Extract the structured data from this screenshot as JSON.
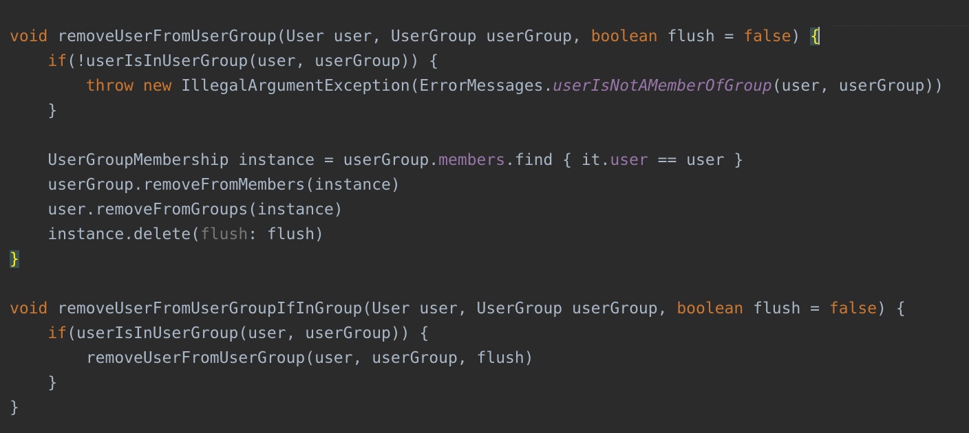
{
  "editor": {
    "lines": [
      {
        "tokens": [
          {
            "text": "void",
            "style": "kw"
          },
          {
            "text": " removeUserFromUserGroup(User user, UserGroup userGroup, ",
            "style": "plain"
          },
          {
            "text": "boolean",
            "style": "kw"
          },
          {
            "text": " flush = ",
            "style": "plain"
          },
          {
            "text": "false",
            "style": "kw"
          },
          {
            "text": ") ",
            "style": "plain"
          },
          {
            "text": "{",
            "style": "brace-match",
            "caret": true
          }
        ]
      },
      {
        "tokens": [
          {
            "text": "    ",
            "style": "plain"
          },
          {
            "text": "if",
            "style": "kw"
          },
          {
            "text": "(!userIsInUserGroup(user, userGroup)) {",
            "style": "plain"
          }
        ]
      },
      {
        "tokens": [
          {
            "text": "        ",
            "style": "plain"
          },
          {
            "text": "throw new",
            "style": "kw"
          },
          {
            "text": " IllegalArgumentException(ErrorMessages.",
            "style": "plain"
          },
          {
            "text": "userIsNotAMemberOfGroup",
            "style": "static"
          },
          {
            "text": "(user, userGroup))",
            "style": "plain"
          }
        ]
      },
      {
        "tokens": [
          {
            "text": "    }",
            "style": "plain"
          }
        ]
      },
      {
        "tokens": []
      },
      {
        "tokens": [
          {
            "text": "    UserGroupMembership instance = userGroup.",
            "style": "plain"
          },
          {
            "text": "members",
            "style": "field"
          },
          {
            "text": ".find { it.",
            "style": "plain"
          },
          {
            "text": "user",
            "style": "field"
          },
          {
            "text": " == user }",
            "style": "plain"
          }
        ]
      },
      {
        "tokens": [
          {
            "text": "    userGroup.removeFromMembers(instance)",
            "style": "plain"
          }
        ]
      },
      {
        "tokens": [
          {
            "text": "    user.removeFromGroups(instance)",
            "style": "plain"
          }
        ]
      },
      {
        "tokens": [
          {
            "text": "    instance.delete(",
            "style": "plain"
          },
          {
            "text": "flush",
            "style": "hint"
          },
          {
            "text": ": flush)",
            "style": "plain"
          }
        ]
      },
      {
        "tokens": [
          {
            "text": "}",
            "style": "brace-match-last"
          }
        ]
      },
      {
        "tokens": []
      },
      {
        "tokens": [
          {
            "text": "void",
            "style": "kw"
          },
          {
            "text": " removeUserFromUserGroupIfInGroup(User user, UserGroup userGroup, ",
            "style": "plain"
          },
          {
            "text": "boolean",
            "style": "kw"
          },
          {
            "text": " flush = ",
            "style": "plain"
          },
          {
            "text": "false",
            "style": "kw"
          },
          {
            "text": ") {",
            "style": "plain"
          }
        ]
      },
      {
        "tokens": [
          {
            "text": "    ",
            "style": "plain"
          },
          {
            "text": "if",
            "style": "kw"
          },
          {
            "text": "(userIsInUserGroup(user, userGroup)) {",
            "style": "plain"
          }
        ]
      },
      {
        "tokens": [
          {
            "text": "        removeUserFromUserGroup(user, userGroup, flush)",
            "style": "plain"
          }
        ]
      },
      {
        "tokens": [
          {
            "text": "    }",
            "style": "plain"
          }
        ]
      },
      {
        "tokens": [
          {
            "text": "}",
            "style": "plain"
          }
        ]
      }
    ]
  },
  "theme": {
    "background": "#2b2b2b",
    "plain": "#a9b7c6",
    "keyword": "#cc7832",
    "static_method": "#9876aa",
    "field": "#9876aa",
    "param_hint": "#787878",
    "brace_match": "#ffef28"
  }
}
